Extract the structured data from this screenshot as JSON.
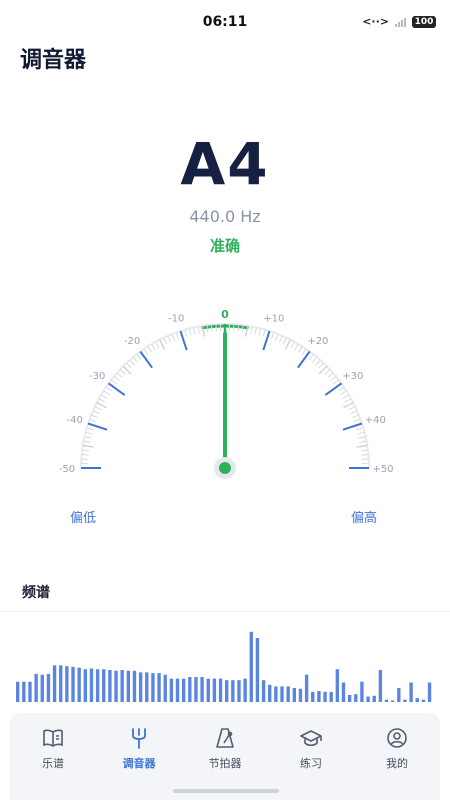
{
  "status_bar": {
    "time": "06:11",
    "data_icon": "<··>",
    "battery": "100"
  },
  "header": {
    "title": "调音器"
  },
  "tuner": {
    "note": "A4",
    "frequency": "440.0 Hz",
    "status": "准确",
    "cents": 0,
    "accent_color": "#2fb15a",
    "tick_color": "#3f74d6"
  },
  "gauge": {
    "labels_left": [
      "-10",
      "-20",
      "-30",
      "-40",
      "-50"
    ],
    "labels_right": [
      "+10",
      "+20",
      "+30",
      "+40",
      "+50"
    ],
    "zero": "0",
    "low_label": "偏低",
    "high_label": "偏高"
  },
  "spectrum": {
    "title": "频谱",
    "bar_color": "#5b86e0",
    "levels": [
      0.26,
      0.26,
      0.26,
      0.36,
      0.35,
      0.36,
      0.47,
      0.47,
      0.46,
      0.45,
      0.44,
      0.42,
      0.43,
      0.42,
      0.42,
      0.41,
      0.4,
      0.41,
      0.4,
      0.4,
      0.38,
      0.38,
      0.37,
      0.37,
      0.35,
      0.3,
      0.3,
      0.3,
      0.32,
      0.32,
      0.32,
      0.3,
      0.3,
      0.3,
      0.28,
      0.28,
      0.28,
      0.3,
      0.9,
      0.82,
      0.28,
      0.22,
      0.2,
      0.2,
      0.2,
      0.18,
      0.17,
      0.35,
      0.13,
      0.14,
      0.13,
      0.13,
      0.42,
      0.25,
      0.09,
      0.1,
      0.26,
      0.07,
      0.08,
      0.41,
      0.03,
      0.02,
      0.18,
      0.03,
      0.25,
      0.05,
      0.03,
      0.25
    ]
  },
  "tabs": [
    {
      "label": "乐谱",
      "icon": "book-icon",
      "active": false
    },
    {
      "label": "调音器",
      "icon": "tuning-fork-icon",
      "active": true
    },
    {
      "label": "节拍器",
      "icon": "metronome-icon",
      "active": false
    },
    {
      "label": "练习",
      "icon": "graduation-cap-icon",
      "active": false
    },
    {
      "label": "我的",
      "icon": "user-icon",
      "active": false
    }
  ]
}
